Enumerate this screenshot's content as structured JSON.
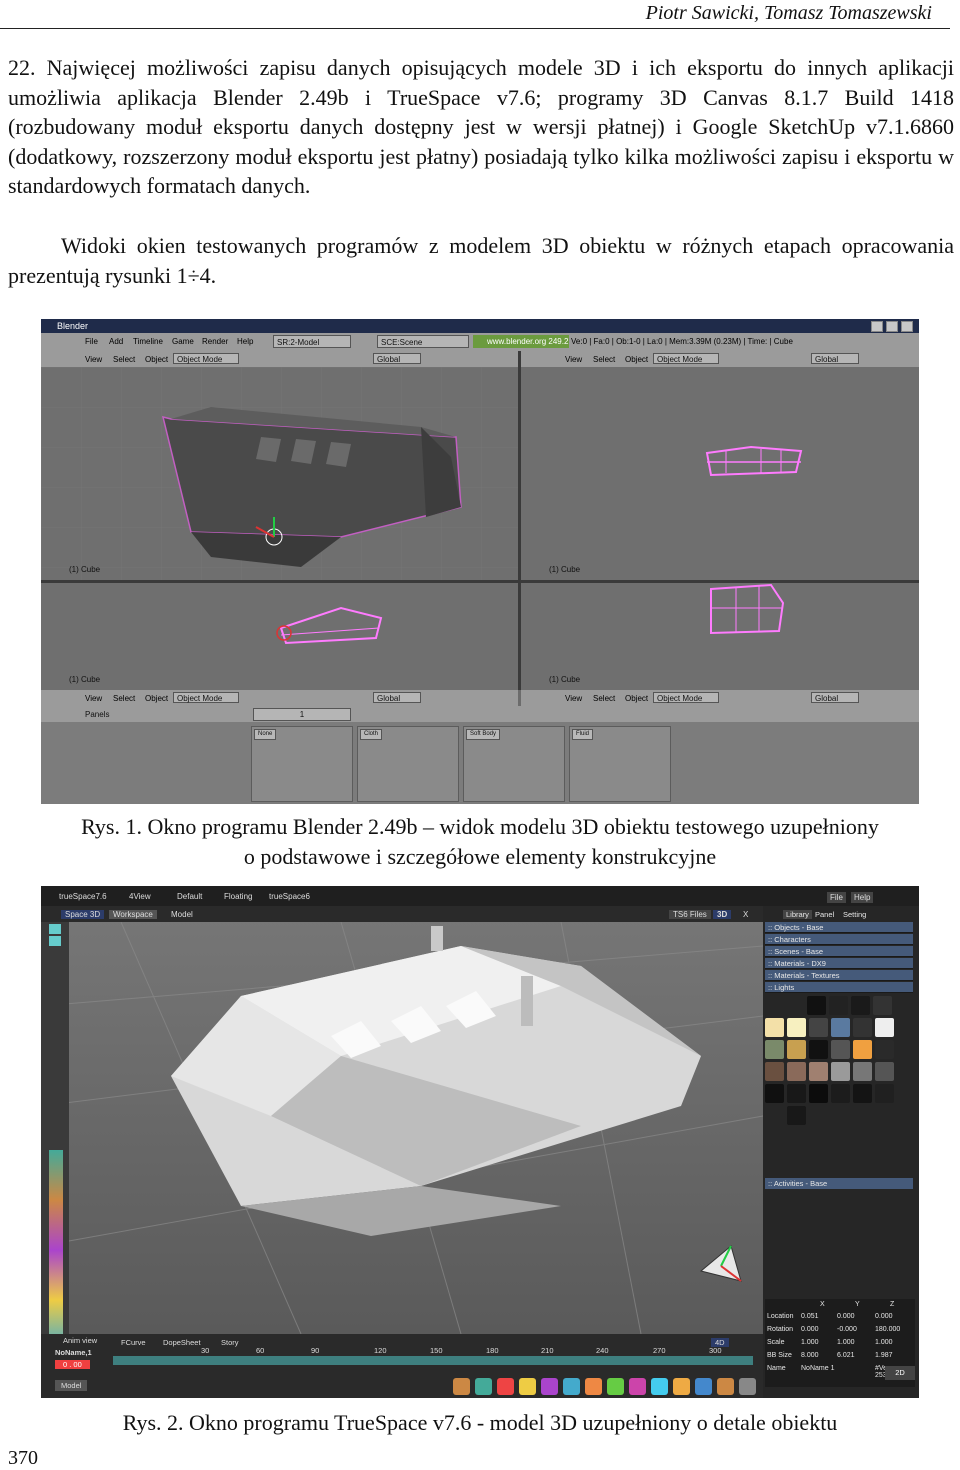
{
  "header": {
    "authors": "Piotr Sawicki, Tomasz Tomaszewski"
  },
  "paragraph1": "22.  Najwięcej możliwości zapisu danych opisujących modele 3D i ich eksportu do innych aplikacji umożliwia aplikacja Blender 2.49b i TrueSpace v7.6; programy 3D Canvas 8.1.7 Build 1418 (rozbudowany moduł eksportu danych dostępny jest w wersji płatnej) i Google SketchUp v7.1.6860 (dodatkowy, rozszerzony moduł eksportu jest płatny) posiadają tylko kilka możliwości zapisu i eksportu w standardowych formatach danych.",
  "paragraph2": "Widoki okien testowanych programów z modelem 3D obiektu w różnych etapach opracowania prezentują rysunki 1÷4.",
  "figure1": {
    "caption_line1": "Rys. 1. Okno programu Blender 2.49b – widok modelu 3D obiektu testowego uzupełniony",
    "caption_line2": "o podstawowe i szczegółowe elementy konstrukcyjne",
    "window_title": "Blender",
    "menu": [
      "File",
      "Add",
      "Timeline",
      "Game",
      "Render",
      "Help"
    ],
    "screen_field": "SR:2-Model",
    "scene_field": "SCE:Scene",
    "url": "www.blender.org 249.2",
    "status": "Ve:0 | Fa:0 | Ob:1-0 | La:0 | Mem:3.39M (0.23M) | Time: | Cube",
    "viewport_menu": [
      "View",
      "Select",
      "Object"
    ],
    "mode": "Object Mode",
    "orientation": "Global",
    "object_label": "(1) Cube",
    "panels_label": "Panels",
    "frame": "1",
    "subpanels": [
      "None",
      "Cloth",
      "Soft Body",
      "Fluid"
    ]
  },
  "figure2": {
    "caption": "Rys. 2. Okno programu TrueSpace v7.6 - model 3D uzupełniony o detale obiektu",
    "app_title": "trueSpace7.6",
    "top_tabs": [
      "4View",
      "Default",
      "Floating",
      "trueSpace6"
    ],
    "file_help": [
      "File",
      "Help"
    ],
    "sub_tabs": [
      "Space 3D",
      "Workspace",
      "Model"
    ],
    "view_badges": [
      "TS6 Files",
      "3D",
      "X"
    ],
    "library_tabs": [
      "Library",
      "Panel",
      "Setting"
    ],
    "library_items": [
      ":: Objects - Base",
      ":: Characters",
      ":: Scenes - Base",
      ":: Materials - DX9",
      ":: Materials - Textures",
      ":: Lights"
    ],
    "activities": ":: Activities - Base",
    "coord_headers": [
      "X",
      "Y",
      "Z"
    ],
    "coords": [
      {
        "label": "Location",
        "x": "0.051",
        "y": "0.000",
        "z": "0.000"
      },
      {
        "label": "Rotation",
        "x": "0.000",
        "y": "-0.000",
        "z": "180.000"
      },
      {
        "label": "Scale",
        "x": "1.000",
        "y": "1.000",
        "z": "1.000"
      },
      {
        "label": "BB Size",
        "x": "8.000",
        "y": "6.021",
        "z": "1.987"
      },
      {
        "label": "Name",
        "x": "NoName 1",
        "y": "",
        "z": "#Ver. 253727"
      }
    ],
    "bottom_tabs": [
      "Anim view",
      "FCurve",
      "DopeSheet",
      "Story"
    ],
    "name_field": "NoName,1",
    "time_field": "0 . 00",
    "timeline_ticks": [
      "30",
      "60",
      "90",
      "120",
      "150",
      "180",
      "210",
      "240",
      "270",
      "300"
    ],
    "view_4d": "4D",
    "view_2d": "2D",
    "model_label": "Model"
  },
  "page_number": "370"
}
